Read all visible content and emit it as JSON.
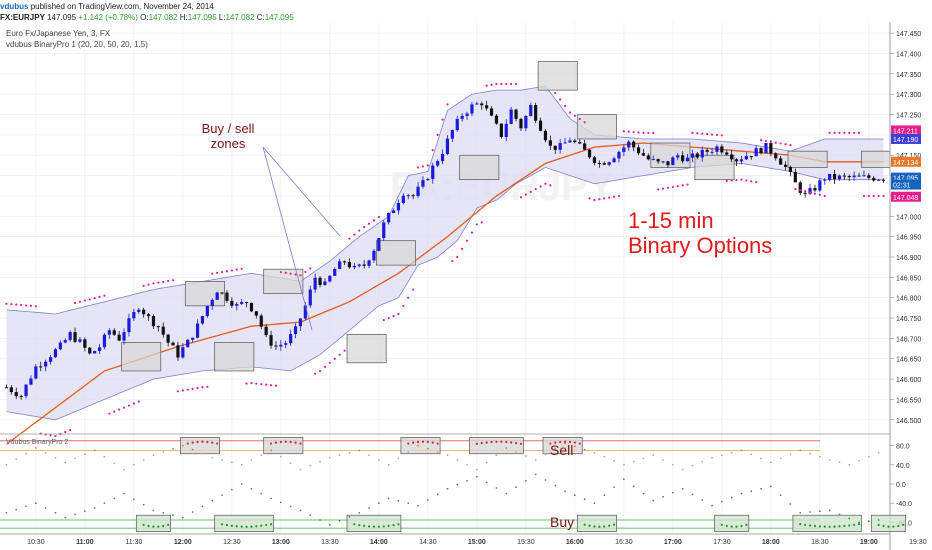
{
  "header": {
    "author": "vdubus",
    "published_text": "published on TradingView.com, November 24, 2014",
    "symbol": "FX:EURJPY",
    "last_price": "147.095",
    "change": "+1.142 (+0.78%)",
    "o_label": "O:",
    "o_value": "147.082",
    "h_label": "H:",
    "h_value": "147.095",
    "l_label": "L:",
    "l_value": "147.082",
    "c_label": "C:",
    "c_value": "147.095"
  },
  "main_chart": {
    "instrument_label": "Euro Fx/Japanese Yen, 3, FX",
    "indicator_label": "vdubus BinaryPro 1 (20, 20, 50, 20, 1.5)",
    "annotation_zones": "Buy / sell\nzones",
    "annotation_big_line1": "1-15 min",
    "annotation_big_line2": "Binary Options"
  },
  "sub_chart": {
    "label": "Vdubus BinaryPro 2",
    "sell_label": "Sell",
    "buy_label": "Buy"
  },
  "colors": {
    "up_candle": "#1a1ad8",
    "down_candle": "#111111",
    "band_fill": "#dcdcf4",
    "band_line": "#8080d0",
    "ma_line": "#e65c1a",
    "dots": "#e0209a",
    "zone_fill": "#d8d8d8",
    "annotation_red": "#e01b1b",
    "annotation_brown": "#7a1515"
  },
  "chart_data": {
    "type": "candlestick",
    "x_tick_labels": [
      "10:00",
      "10:30",
      "11:00",
      "11:30",
      "12:00",
      "12:30",
      "13:00",
      "13:30",
      "14:00",
      "14:30",
      "15:00",
      "15:30",
      "16:00",
      "16:30",
      "17:00",
      "17:30",
      "18:00",
      "18:30",
      "19:00",
      "19:30",
      "20:00"
    ],
    "bold_x_ticks": [
      "11:00",
      "12:00",
      "13:00",
      "14:00",
      "15:00",
      "16:00",
      "17:00",
      "18:00",
      "19:00",
      "20:00"
    ],
    "y_tick_labels": [
      "146.500",
      "146.550",
      "146.600",
      "146.650",
      "146.700",
      "146.750",
      "146.800",
      "146.850",
      "146.900",
      "146.950",
      "147.000",
      "147.050",
      "147.100",
      "147.150",
      "147.200",
      "147.250",
      "147.300",
      "147.350",
      "147.400",
      "147.450"
    ],
    "ylim": [
      146.47,
      147.47
    ],
    "price_tags": [
      {
        "text": "147.211",
        "value": 147.211,
        "color": "#e91e8c"
      },
      {
        "text": "147.190",
        "value": 147.19,
        "color": "#3f3fd8"
      },
      {
        "text": "147.134",
        "value": 147.134,
        "color": "#e8782a"
      },
      {
        "text": "147.095",
        "value": 147.095,
        "color": "#1565c0"
      },
      {
        "text": "02:31",
        "value": 147.078,
        "color": "#1565c0"
      },
      {
        "text": "147.048",
        "value": 147.048,
        "color": "#e91e8c"
      }
    ],
    "close_path": [
      [
        0,
        146.58
      ],
      [
        3,
        146.56
      ],
      [
        6,
        146.63
      ],
      [
        9,
        146.66
      ],
      [
        11,
        146.68
      ],
      [
        13,
        146.71
      ],
      [
        15,
        146.69
      ],
      [
        17,
        146.66
      ],
      [
        19,
        146.68
      ],
      [
        21,
        146.72
      ],
      [
        23,
        146.7
      ],
      [
        25,
        146.74
      ],
      [
        27,
        146.78
      ],
      [
        29,
        146.75
      ],
      [
        31,
        146.73
      ],
      [
        33,
        146.69
      ],
      [
        35,
        146.66
      ],
      [
        37,
        146.69
      ],
      [
        39,
        146.73
      ],
      [
        41,
        146.78
      ],
      [
        43,
        146.82
      ],
      [
        45,
        146.8
      ],
      [
        47,
        146.78
      ],
      [
        49,
        146.79
      ],
      [
        51,
        146.76
      ],
      [
        53,
        146.7
      ],
      [
        55,
        146.68
      ],
      [
        57,
        146.69
      ],
      [
        59,
        146.72
      ],
      [
        61,
        146.78
      ],
      [
        63,
        146.85
      ],
      [
        65,
        146.83
      ],
      [
        67,
        146.87
      ],
      [
        69,
        146.89
      ],
      [
        71,
        146.87
      ],
      [
        73,
        146.88
      ],
      [
        75,
        146.92
      ],
      [
        77,
        146.98
      ],
      [
        79,
        147.02
      ],
      [
        81,
        147.06
      ],
      [
        83,
        147.05
      ],
      [
        85,
        147.08
      ],
      [
        87,
        147.12
      ],
      [
        89,
        147.16
      ],
      [
        91,
        147.21
      ],
      [
        93,
        147.25
      ],
      [
        95,
        147.27
      ],
      [
        97,
        147.28
      ],
      [
        99,
        147.24
      ],
      [
        101,
        147.2
      ],
      [
        103,
        147.26
      ],
      [
        105,
        147.22
      ],
      [
        107,
        147.27
      ],
      [
        109,
        147.22
      ],
      [
        111,
        147.17
      ],
      [
        113,
        147.17
      ],
      [
        115,
        147.19
      ],
      [
        117,
        147.17
      ],
      [
        119,
        147.15
      ],
      [
        121,
        147.13
      ],
      [
        123,
        147.14
      ],
      [
        125,
        147.16
      ],
      [
        127,
        147.18
      ],
      [
        129,
        147.16
      ],
      [
        131,
        147.14
      ],
      [
        133,
        147.13
      ],
      [
        135,
        147.13
      ],
      [
        137,
        147.15
      ],
      [
        139,
        147.14
      ],
      [
        141,
        147.15
      ],
      [
        143,
        147.16
      ],
      [
        145,
        147.17
      ],
      [
        147,
        147.16
      ],
      [
        149,
        147.14
      ],
      [
        151,
        147.15
      ],
      [
        153,
        147.16
      ],
      [
        155,
        147.17
      ],
      [
        157,
        147.15
      ],
      [
        159,
        147.12
      ],
      [
        161,
        147.08
      ],
      [
        163,
        147.05
      ],
      [
        165,
        147.07
      ],
      [
        167,
        147.095
      ]
    ],
    "moving_average": [
      [
        0,
        146.44
      ],
      [
        20,
        146.62
      ],
      [
        35,
        146.68
      ],
      [
        50,
        146.73
      ],
      [
        60,
        146.74
      ],
      [
        70,
        146.79
      ],
      [
        80,
        146.86
      ],
      [
        90,
        146.95
      ],
      [
        100,
        147.05
      ],
      [
        110,
        147.13
      ],
      [
        120,
        147.17
      ],
      [
        130,
        147.18
      ],
      [
        140,
        147.17
      ],
      [
        150,
        147.16
      ],
      [
        160,
        147.15
      ],
      [
        167,
        147.134
      ]
    ],
    "upper_band": [
      [
        0,
        146.77
      ],
      [
        10,
        146.76
      ],
      [
        20,
        146.79
      ],
      [
        30,
        146.82
      ],
      [
        40,
        146.84
      ],
      [
        50,
        146.86
      ],
      [
        60,
        146.84
      ],
      [
        66,
        146.89
      ],
      [
        72,
        146.95
      ],
      [
        78,
        147.0
      ],
      [
        82,
        147.1
      ],
      [
        86,
        147.11
      ],
      [
        90,
        147.26
      ],
      [
        95,
        147.3
      ],
      [
        100,
        147.31
      ],
      [
        105,
        147.31
      ],
      [
        110,
        147.32
      ],
      [
        115,
        147.24
      ],
      [
        120,
        147.2
      ],
      [
        130,
        147.19
      ],
      [
        140,
        147.19
      ],
      [
        150,
        147.18
      ],
      [
        160,
        147.16
      ],
      [
        167,
        147.19
      ]
    ],
    "lower_band": [
      [
        0,
        146.52
      ],
      [
        10,
        146.5
      ],
      [
        20,
        146.55
      ],
      [
        30,
        146.6
      ],
      [
        40,
        146.62
      ],
      [
        50,
        146.63
      ],
      [
        58,
        146.62
      ],
      [
        64,
        146.66
      ],
      [
        70,
        146.72
      ],
      [
        76,
        146.78
      ],
      [
        80,
        146.8
      ],
      [
        84,
        146.88
      ],
      [
        88,
        146.9
      ],
      [
        92,
        146.94
      ],
      [
        96,
        147.02
      ],
      [
        100,
        147.04
      ],
      [
        104,
        147.08
      ],
      [
        110,
        147.12
      ],
      [
        120,
        147.08
      ],
      [
        130,
        147.1
      ],
      [
        140,
        147.12
      ],
      [
        150,
        147.13
      ],
      [
        160,
        147.11
      ],
      [
        167,
        147.09
      ]
    ],
    "zone_boxes": [
      {
        "bar": 24,
        "bars": 8,
        "top": 146.69,
        "bottom": 146.62
      },
      {
        "bar": 37,
        "bars": 8,
        "top": 146.84,
        "bottom": 146.78
      },
      {
        "bar": 43,
        "bars": 8,
        "top": 146.69,
        "bottom": 146.62
      },
      {
        "bar": 53,
        "bars": 8,
        "top": 146.87,
        "bottom": 146.81
      },
      {
        "bar": 70,
        "bars": 8,
        "top": 146.71,
        "bottom": 146.64
      },
      {
        "bar": 76,
        "bars": 8,
        "top": 146.94,
        "bottom": 146.88
      },
      {
        "bar": 93,
        "bars": 8,
        "top": 147.15,
        "bottom": 147.09
      },
      {
        "bar": 109,
        "bars": 8,
        "top": 147.38,
        "bottom": 147.31
      },
      {
        "bar": 117,
        "bars": 8,
        "top": 147.25,
        "bottom": 147.19
      },
      {
        "bar": 132,
        "bars": 8,
        "top": 147.18,
        "bottom": 147.12
      },
      {
        "bar": 141,
        "bars": 8,
        "top": 147.15,
        "bottom": 147.09
      },
      {
        "bar": 160,
        "bars": 8,
        "top": 147.16,
        "bottom": 147.12
      },
      {
        "bar": 175,
        "bars": 8,
        "top": 147.16,
        "bottom": 147.12
      }
    ],
    "oscillator": {
      "y_tick_labels": [
        "80.0",
        "40.0",
        "0.0",
        "-40.0",
        "-80.0"
      ],
      "ylim": [
        -100,
        100
      ],
      "sell_levels": [
        90,
        70
      ],
      "buy_levels": [
        -75,
        -92
      ],
      "sell_zones": [
        {
          "bar": 36,
          "bars": 8
        },
        {
          "bar": 53,
          "bars": 8
        },
        {
          "bar": 81,
          "bars": 8
        },
        {
          "bar": 95,
          "bars": 11
        },
        {
          "bar": 110,
          "bars": 8
        }
      ],
      "buy_zones": [
        {
          "bar": 27,
          "bars": 7
        },
        {
          "bar": 43,
          "bars": 12
        },
        {
          "bar": 70,
          "bars": 11
        },
        {
          "bar": 117,
          "bars": 8
        },
        {
          "bar": 145,
          "bars": 7
        },
        {
          "bar": 161,
          "bars": 14
        },
        {
          "bar": 177,
          "bars": 7
        }
      ],
      "series_gray": [
        [
          0,
          40
        ],
        [
          6,
          75
        ],
        [
          12,
          45
        ],
        [
          18,
          70
        ],
        [
          24,
          30
        ],
        [
          30,
          60
        ],
        [
          36,
          80
        ],
        [
          42,
          55
        ],
        [
          48,
          40
        ],
        [
          54,
          70
        ],
        [
          60,
          30
        ],
        [
          66,
          55
        ],
        [
          72,
          70
        ],
        [
          78,
          40
        ],
        [
          84,
          80
        ],
        [
          90,
          60
        ],
        [
          96,
          30
        ],
        [
          102,
          75
        ],
        [
          108,
          50
        ],
        [
          114,
          85
        ],
        [
          120,
          65
        ],
        [
          126,
          40
        ],
        [
          132,
          60
        ],
        [
          138,
          30
        ],
        [
          144,
          55
        ],
        [
          150,
          70
        ],
        [
          156,
          45
        ],
        [
          162,
          70
        ],
        [
          168,
          50
        ],
        [
          172,
          40
        ],
        [
          178,
          65
        ]
      ],
      "series_black": [
        [
          0,
          -60
        ],
        [
          6,
          -40
        ],
        [
          12,
          -70
        ],
        [
          18,
          -50
        ],
        [
          24,
          -20
        ],
        [
          30,
          -55
        ],
        [
          36,
          -70
        ],
        [
          42,
          -35
        ],
        [
          48,
          0
        ],
        [
          54,
          -30
        ],
        [
          60,
          -55
        ],
        [
          66,
          -85
        ],
        [
          72,
          -60
        ],
        [
          78,
          -30
        ],
        [
          84,
          -45
        ],
        [
          90,
          -10
        ],
        [
          96,
          15
        ],
        [
          102,
          -20
        ],
        [
          108,
          20
        ],
        [
          114,
          -15
        ],
        [
          120,
          -40
        ],
        [
          126,
          10
        ],
        [
          132,
          -35
        ],
        [
          138,
          -10
        ],
        [
          144,
          -45
        ],
        [
          150,
          -20
        ],
        [
          156,
          -5
        ],
        [
          162,
          -60
        ],
        [
          168,
          -55
        ],
        [
          174,
          -80
        ],
        [
          178,
          -75
        ]
      ]
    }
  }
}
